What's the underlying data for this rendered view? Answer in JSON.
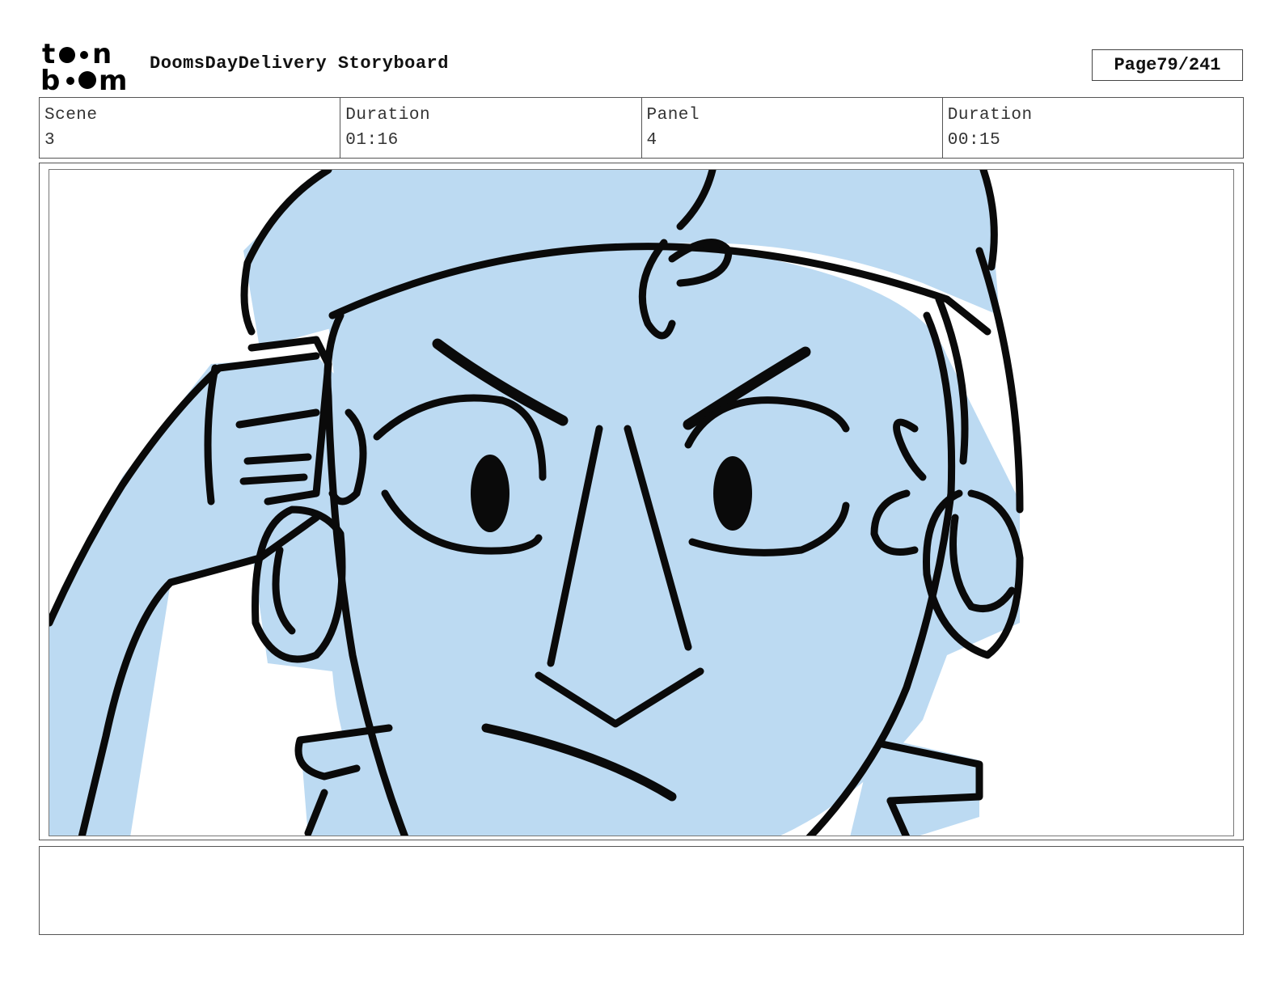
{
  "header": {
    "logo_text_top": "toon",
    "logo_text_bottom": "boom",
    "title": "DoomsDayDelivery Storyboard",
    "page_label": "Page",
    "page_number": "79/241"
  },
  "info": {
    "scene_label": "Scene",
    "scene_value": "3",
    "scene_duration_label": "Duration",
    "scene_duration_value": "01:16",
    "panel_label": "Panel",
    "panel_value": "4",
    "panel_duration_label": "Duration",
    "panel_duration_value": "00:15"
  },
  "panel": {
    "fill_color": "#bcdaf2",
    "line_color": "#0a0a0a",
    "drawing": "storyboard-sketch"
  },
  "caption": {
    "text": ""
  }
}
